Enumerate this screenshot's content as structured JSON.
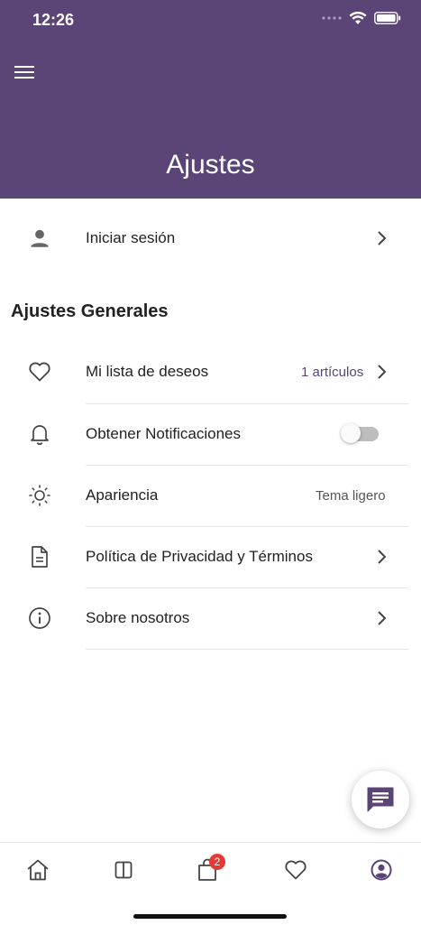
{
  "status_bar": {
    "time": "12:26"
  },
  "header": {
    "title": "Ajustes"
  },
  "login": {
    "label": "Iniciar sesión"
  },
  "general_section": {
    "title": "Ajustes Generales",
    "items": [
      {
        "label": "Mi lista de deseos",
        "value": "1 artículos",
        "icon": "heart-icon"
      },
      {
        "label": "Obtener Notificaciones",
        "toggle": "off",
        "icon": "bell-icon"
      },
      {
        "label": "Apariencia",
        "value": "Tema ligero",
        "icon": "sun-icon"
      },
      {
        "label": "Política de Privacidad y Términos",
        "icon": "document-icon"
      },
      {
        "label": "Sobre nosotros",
        "icon": "info-icon"
      }
    ]
  },
  "bottom_nav": {
    "tabs": [
      "home",
      "categories",
      "cart",
      "wishlist",
      "profile"
    ],
    "cart_badge": "2",
    "active": "profile"
  },
  "colors": {
    "primary": "#5b4476",
    "badge": "#e53935"
  }
}
